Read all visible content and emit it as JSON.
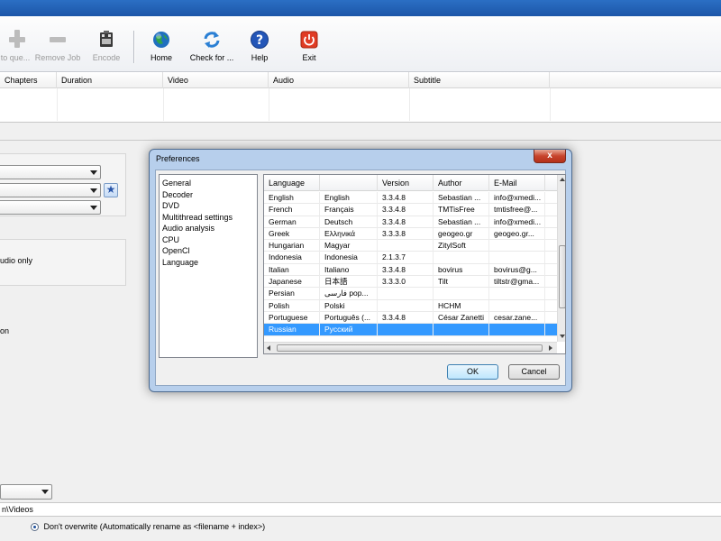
{
  "toolbar": {
    "buttons": [
      {
        "label": "to que...",
        "icon": "plus-icon",
        "enabled": false
      },
      {
        "label": "Remove Job",
        "icon": "minus-icon",
        "enabled": false
      },
      {
        "label": "Encode",
        "icon": "film-encode-icon",
        "enabled": false
      },
      {
        "label": "Home",
        "icon": "globe-icon",
        "enabled": true
      },
      {
        "label": "Check for ...",
        "icon": "refresh-arrows-icon",
        "enabled": true
      },
      {
        "label": "Help",
        "icon": "question-icon",
        "enabled": true
      },
      {
        "label": "Exit",
        "icon": "power-icon",
        "enabled": true
      }
    ]
  },
  "queue": {
    "columns": [
      "Chapters",
      "Duration",
      "Video",
      "Audio",
      "Subtitle"
    ]
  },
  "background": {
    "audio_text": "udio only",
    "option_text": "on",
    "path_value": "n\\Videos",
    "overwrite_label": "Don't overwrite (Automatically rename as <filename + index>)"
  },
  "dialog": {
    "title": "Preferences",
    "close_glyph": "x",
    "tree": [
      "General",
      "Decoder",
      "DVD",
      "Multithread settings",
      "Audio analysis",
      "CPU",
      "OpenCl",
      "Language"
    ],
    "columns": [
      "Language",
      "",
      "Version",
      "Author",
      "E-Mail"
    ],
    "rows": [
      [
        "English",
        "English",
        "3.3.4.8",
        "Sebastian ...",
        "info@xmedi..."
      ],
      [
        "French",
        "Français",
        "3.3.4.8",
        "TMTisFree",
        "tmtisfree@..."
      ],
      [
        "German",
        "Deutsch",
        "3.3.4.8",
        "Sebastian ...",
        "info@xmedi..."
      ],
      [
        "Greek",
        "Ελληνικά",
        "3.3.3.8",
        "geogeo.gr",
        "geogeo.gr..."
      ],
      [
        "Hungarian",
        "Magyar",
        "",
        "ZitylSoft",
        ""
      ],
      [
        "Indonesia",
        "Indonesia",
        "2.1.3.7",
        "",
        ""
      ],
      [
        "Italian",
        "Italiano",
        "3.3.4.8",
        "bovirus",
        "bovirus@g..."
      ],
      [
        "Japanese",
        "日本語",
        "3.3.3.0",
        "Tilt",
        "tiltstr@gma..."
      ],
      [
        "Persian",
        "فارسی pop...",
        "",
        "",
        ""
      ],
      [
        "Polish",
        "Polski",
        "",
        "HCHM",
        ""
      ],
      [
        "Portuguese",
        "Português (...",
        "3.3.4.8",
        "César Zanetti",
        "cesar.zane..."
      ],
      [
        "Russian",
        "Русский",
        "",
        "",
        ""
      ]
    ],
    "selected_row": 11,
    "ok_label": "OK",
    "cancel_label": "Cancel"
  }
}
